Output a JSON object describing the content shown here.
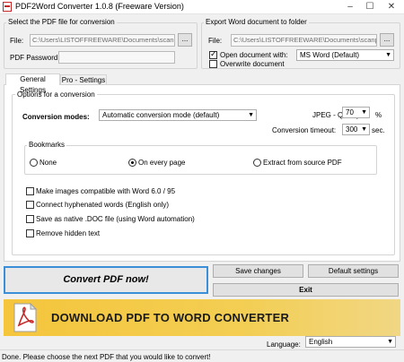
{
  "window": {
    "title": "PDF2Word Converter 1.0.8 (Freeware Version)",
    "icon": "pdf-app-icon"
  },
  "source": {
    "group_title": "Select the PDF file for conversion",
    "file_label": "File:",
    "file_value": "C:\\Users\\LISTOFFREEWARE\\Documents\\scanpd",
    "browse_label": "...",
    "password_label": "PDF Password:",
    "password_value": ""
  },
  "export": {
    "group_title": "Export Word document to folder",
    "file_label": "File:",
    "file_value": "C:\\Users\\LISTOFFREEWARE\\Documents\\scanpd",
    "browse_label": "...",
    "open_with_label": "Open document with:",
    "open_with_checked": true,
    "open_with_value": "MS Word (Default)",
    "overwrite_label": "Overwrite document",
    "overwrite_checked": false
  },
  "tabs": [
    {
      "label": "General Settings",
      "active": true
    },
    {
      "label": "Pro - Settings",
      "active": false
    }
  ],
  "options": {
    "group_title": "Options for a conversion",
    "conversion_modes_label": "Conversion modes:",
    "conversion_mode_value": "Automatic conversion mode (default)",
    "jpeg_label": "JPEG - Quality:",
    "jpeg_value": "70",
    "jpeg_unit": "%",
    "timeout_label": "Conversion timeout:",
    "timeout_value": "300",
    "timeout_unit": "sec."
  },
  "bookmarks": {
    "group_title": "Bookmarks",
    "options": [
      {
        "label": "None",
        "selected": false
      },
      {
        "label": "On every page",
        "selected": true
      },
      {
        "label": "Extract from source PDF",
        "selected": false
      }
    ]
  },
  "checkboxes": [
    {
      "label": "Make images compatible with Word 6.0 / 95",
      "checked": false
    },
    {
      "label": "Connect hyphenated words (English only)",
      "checked": false
    },
    {
      "label": "Save as native .DOC file (using Word automation)",
      "checked": false
    },
    {
      "label": "Remove hidden text",
      "checked": false
    }
  ],
  "actions": {
    "convert_label": "Convert PDF now!",
    "save_label": "Save changes",
    "default_label": "Default settings",
    "exit_label": "Exit"
  },
  "banner": {
    "text": "DOWNLOAD PDF TO WORD CONVERTER"
  },
  "language": {
    "label": "Language:",
    "value": "English"
  },
  "status": {
    "text": "Done. Please choose the next PDF that you would like to convert!"
  },
  "colors": {
    "accent": "#3b8fd9",
    "banner": "#f3ce53",
    "pdf_red": "#c62828"
  }
}
